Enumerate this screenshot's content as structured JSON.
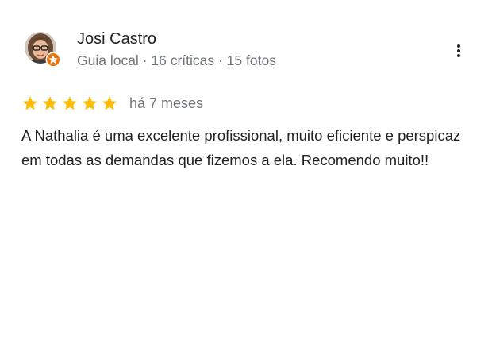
{
  "reviewer": {
    "name": "Josi Castro",
    "meta": "Guia local · 16 críticas · 15 fotos",
    "avatar_icon": "user-photo",
    "badge_icon": "local-guide-star-icon"
  },
  "menu": {
    "icon": "more-vert-icon"
  },
  "review": {
    "rating": 5,
    "rating_max": 5,
    "date": "há 7 meses",
    "text": "A Nathalia é uma excelente profissional, muito eficiente e perspicaz em todas as demandas que fizemos a ela. Recomendo muito!!"
  },
  "colors": {
    "star": "#fbbc04",
    "badge": "#e8710a",
    "primary_text": "#202124",
    "secondary_text": "#70757a"
  }
}
